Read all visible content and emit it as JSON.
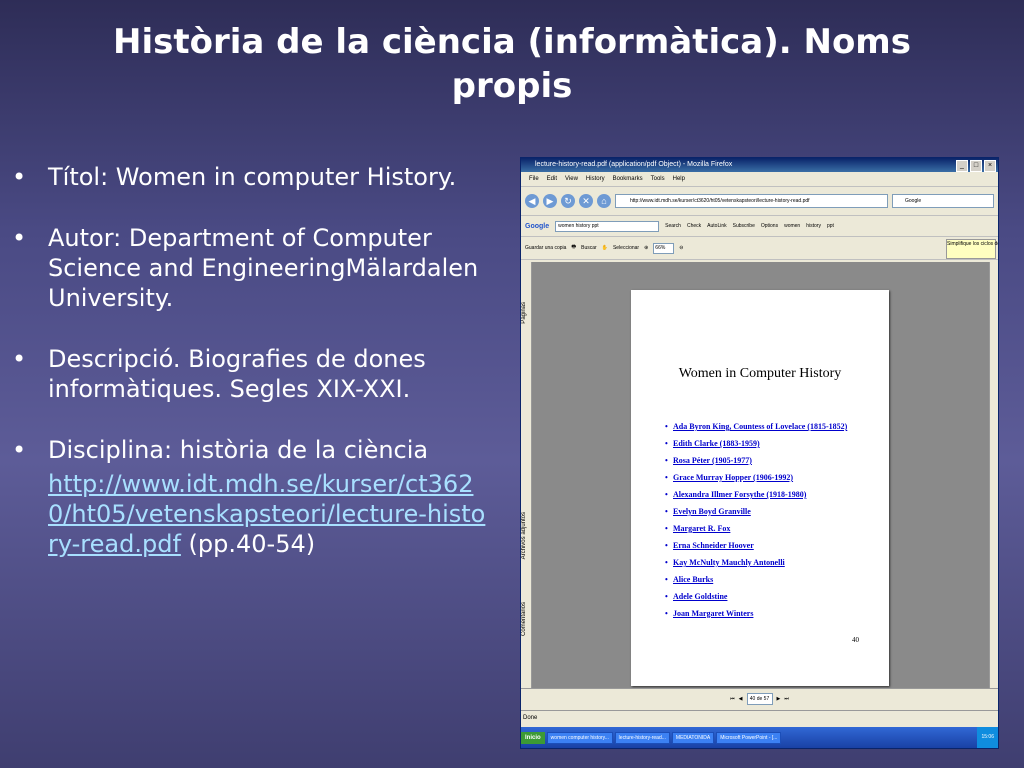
{
  "slide": {
    "title": "Història de la ciència (informàtica). Noms propis",
    "bullets": [
      {
        "text": "Títol: Women in computer History."
      },
      {
        "text": "Autor: Department of Computer Science and EngineeringMälardalen University."
      },
      {
        "text": "Descripció. Biografies de dones informàtiques. Segles XIX-XXI."
      },
      {
        "text": "Disciplina: història de la ciència",
        "link": "http://www.idt.mdh.se/kurser/ct3620/ht05/vetenskapsteori/lecture-history-read.pdf",
        "after_link": " (pp.40-54)"
      }
    ]
  },
  "browser": {
    "window_title": "lecture-history-read.pdf (application/pdf Object) - Mozilla Firefox",
    "menu": [
      "File",
      "Edit",
      "View",
      "History",
      "Bookmarks",
      "Tools",
      "Help"
    ],
    "url": "http://www.idt.mdh.se/kurser/ct3620/ht05/vetenskapsteori/lecture-history-read.pdf",
    "search_engine": "Google",
    "google_toolbar": {
      "query": "women history ppt",
      "items": [
        "Search",
        "Check",
        "AutoLink",
        "Subscribe",
        "Options",
        "women",
        "history",
        "ppt"
      ]
    },
    "pdf_toolbar": {
      "save_copy": "Guardar una copia",
      "search": "Buscar",
      "select": "Seleccionar",
      "zoom": "66%",
      "tip": "Simplifique los ciclos de revisión"
    },
    "side_tabs": [
      "Páginas",
      "Archivos adjuntos",
      "Comentarios"
    ],
    "pdf_page": {
      "title": "Women in Computer History",
      "items": [
        "Ada Byron King, Countess of Lovelace (1815-1852)",
        "Edith Clarke (1883-1959)",
        "Rosa Péter (1905-1977)",
        "Grace Murray Hopper (1906-1992)",
        "Alexandra Illmer Forsythe (1918-1980)",
        "Evelyn Boyd Granville",
        "Margaret R. Fox",
        "Erna Schneider Hoover",
        "Kay McNulty Mauchly Antonelli",
        "Alice Burks",
        "Adele Goldstine",
        "Joan Margaret Winters"
      ],
      "page_number": "40"
    },
    "page_indicator": "40 de 57",
    "status": "Done",
    "taskbar": {
      "start": "Inicio",
      "tasks": [
        "women computer history...",
        "lecture-history-read...",
        "MEDIATONIDA",
        "Microsoft PowerPoint - [..."
      ],
      "clock": "15:06"
    }
  }
}
